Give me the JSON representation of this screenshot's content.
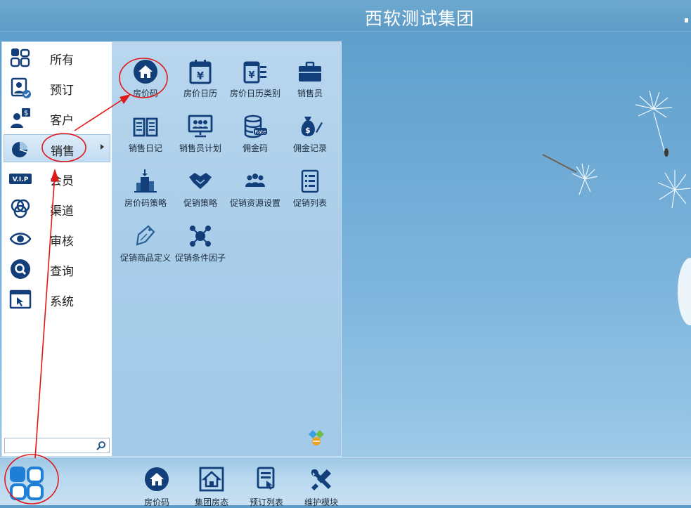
{
  "window": {
    "title": "西软测试集团"
  },
  "categories": [
    {
      "label": "所有",
      "icon": "all-apps-icon"
    },
    {
      "label": "预订",
      "icon": "reservation-icon"
    },
    {
      "label": "客户",
      "icon": "customer-icon"
    },
    {
      "label": "销售",
      "icon": "sales-icon",
      "active": true
    },
    {
      "label": "会员",
      "icon": "vip-icon"
    },
    {
      "label": "渠道",
      "icon": "channel-icon"
    },
    {
      "label": "审核",
      "icon": "audit-icon"
    },
    {
      "label": "查询",
      "icon": "query-icon"
    },
    {
      "label": "系统",
      "icon": "system-icon"
    }
  ],
  "search": {
    "value": "",
    "placeholder": ""
  },
  "modules": [
    {
      "label": "房价码",
      "icon": "home-icon"
    },
    {
      "label": "房价日历",
      "icon": "price-calendar-icon"
    },
    {
      "label": "房价日历类别",
      "icon": "price-calendar-category-icon"
    },
    {
      "label": "销售员",
      "icon": "briefcase-icon"
    },
    {
      "label": "销售日记",
      "icon": "open-book-icon"
    },
    {
      "label": "销售员计划",
      "icon": "presentation-icon"
    },
    {
      "label": "佣金码",
      "icon": "rate-database-icon"
    },
    {
      "label": "佣金记录",
      "icon": "money-bag-icon"
    },
    {
      "label": "房价码策略",
      "icon": "building-icon"
    },
    {
      "label": "促销策略",
      "icon": "handshake-icon"
    },
    {
      "label": "促销资源设置",
      "icon": "group-icon"
    },
    {
      "label": "促销列表",
      "icon": "list-icon"
    },
    {
      "label": "促销商品定义",
      "icon": "price-tag-icon"
    },
    {
      "label": "促销条件因子",
      "icon": "network-icon"
    }
  ],
  "taskbar": [
    {
      "label": "房价码",
      "icon": "home-icon"
    },
    {
      "label": "集团房态",
      "icon": "group-house-icon"
    },
    {
      "label": "预订列表",
      "icon": "reservation-list-icon"
    },
    {
      "label": "维护模块",
      "icon": "tools-icon"
    }
  ],
  "colors": {
    "icon_blue": "#123f7a",
    "annotation_red": "#e01818",
    "active_bg": "#c3dcf2"
  }
}
